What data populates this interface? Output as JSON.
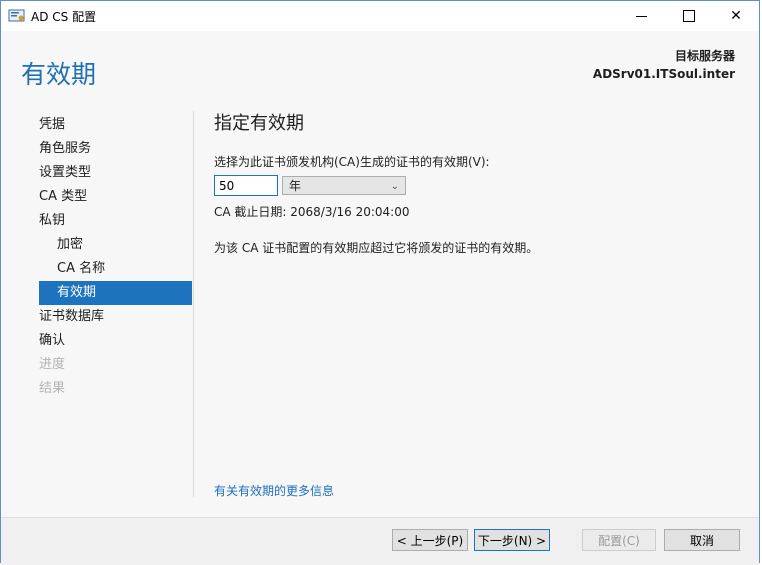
{
  "window": {
    "title": "AD CS 配置",
    "icon": "certificate-app-icon"
  },
  "header": {
    "page_title": "有效期",
    "target_label": "目标服务器",
    "target_server": "ADSrv01.ITSoul.inter"
  },
  "nav": {
    "items": [
      {
        "label": "凭据"
      },
      {
        "label": "角色服务"
      },
      {
        "label": "设置类型"
      },
      {
        "label": "CA 类型"
      },
      {
        "label": "私钥"
      },
      {
        "label": "加密"
      },
      {
        "label": "CA 名称"
      },
      {
        "label": "有效期"
      },
      {
        "label": "证书数据库"
      },
      {
        "label": "确认"
      },
      {
        "label": "进度"
      },
      {
        "label": "结果"
      }
    ],
    "active": "有效期"
  },
  "content": {
    "section_title": "指定有效期",
    "period_label": "选择为此证书颁发机构(CA)生成的证书的有效期(V):",
    "period_value": "50",
    "period_unit": "年",
    "expiry_text": "CA 截止日期: 2068/3/16 20:04:00",
    "note": "为该 CA 证书配置的有效期应超过它将颁发的证书的有效期。",
    "more_info_link": "有关有效期的更多信息"
  },
  "footer": {
    "prev_label": "< 上一步(P)",
    "next_label": "下一步(N) >",
    "config_label": "配置(C)",
    "cancel_label": "取消"
  },
  "colors": {
    "accent": "#1e73be",
    "heading": "#1f6fb5",
    "link": "#1e6fc0",
    "disabled": "#b4b4b4"
  }
}
